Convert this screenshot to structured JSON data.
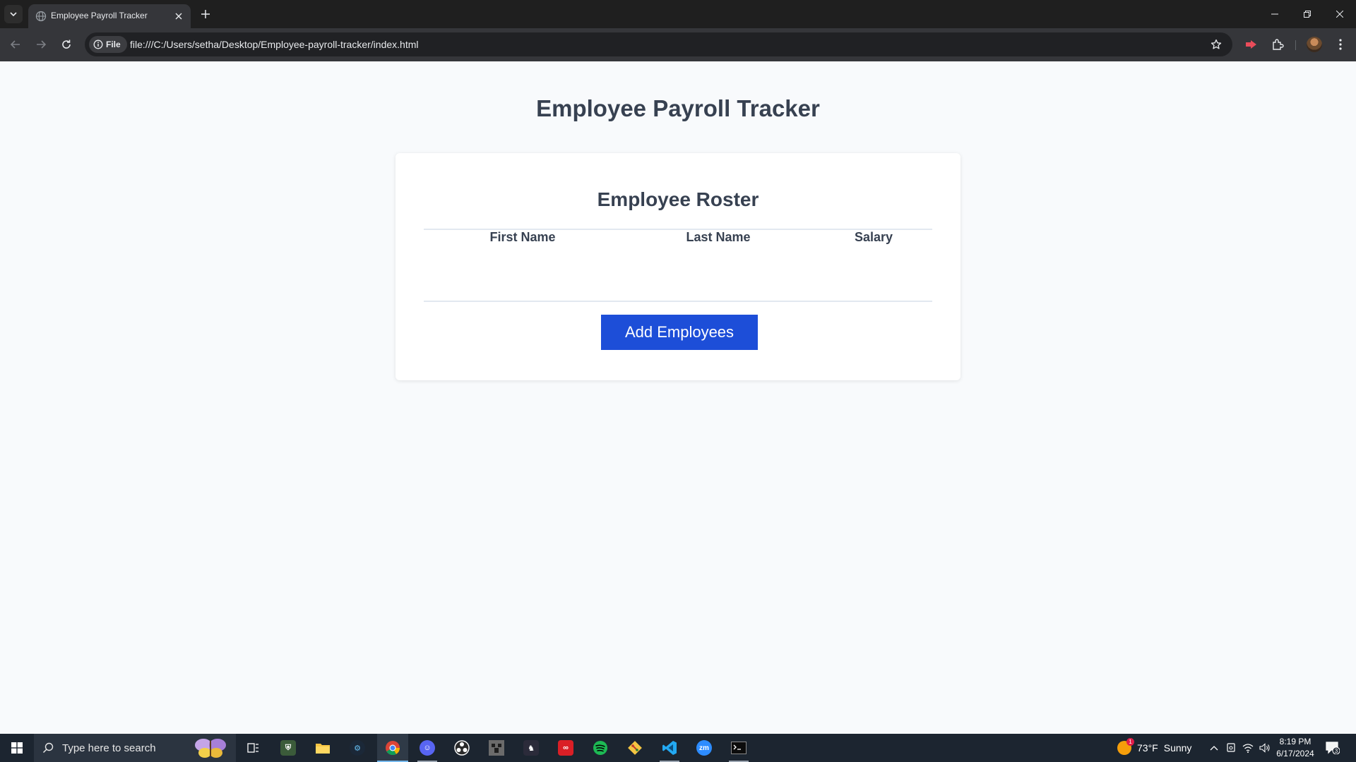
{
  "browser": {
    "tab_title": "Employee Payroll Tracker",
    "security_chip_label": "File",
    "url": "file:///C:/Users/setha/Desktop/Employee-payroll-tracker/index.html"
  },
  "page": {
    "title": "Employee Payroll Tracker",
    "roster": {
      "title": "Employee Roster",
      "columns": [
        "First Name",
        "Last Name",
        "Salary"
      ],
      "rows": []
    },
    "add_button_label": "Add Employees"
  },
  "taskbar": {
    "search_placeholder": "Type here to search",
    "pinned_apps": [
      "task-view",
      "minecraft-dungeons",
      "file-explorer",
      "steam",
      "chrome",
      "discord",
      "obs-studio",
      "minecraft",
      "game-launcher",
      "creative-cloud",
      "spotify",
      "git",
      "vscode",
      "zoom",
      "terminal"
    ],
    "weather_temp": "73°F",
    "weather_condition": "Sunny",
    "weather_badge": "1",
    "time": "8:19 PM",
    "date": "6/17/2024",
    "notification_count": "3"
  },
  "colors": {
    "accent_button": "#1d4ed8",
    "heading_text": "#374151",
    "page_background": "#f8fafc"
  }
}
